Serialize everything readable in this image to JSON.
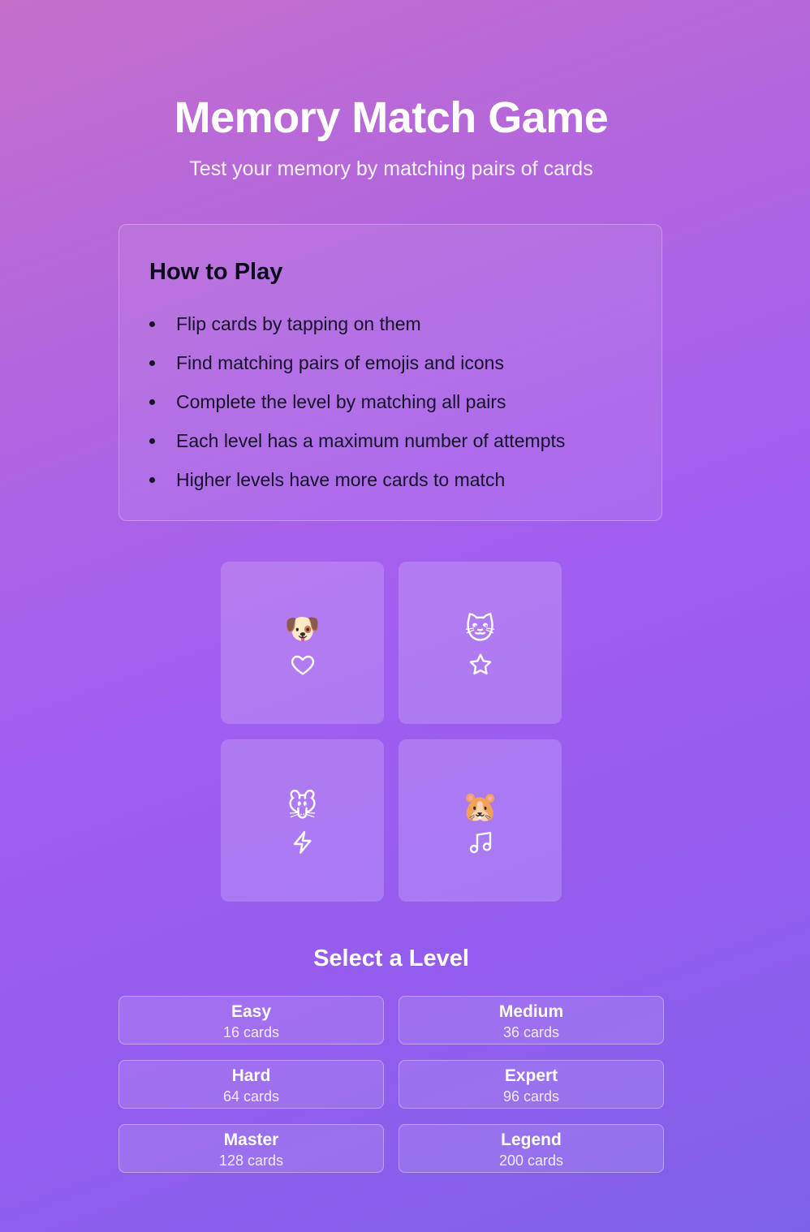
{
  "header": {
    "title": "Memory Match Game",
    "subtitle": "Test your memory by matching pairs of cards"
  },
  "how_to_play": {
    "heading": "How to Play",
    "rules": [
      "Flip cards by tapping on them",
      "Find matching pairs of emojis and icons",
      "Complete the level by matching all pairs",
      "Each level has a maximum number of attempts",
      "Higher levels have more cards to match"
    ]
  },
  "preview_cards": [
    {
      "emoji": "🐶",
      "icon": "heart-icon"
    },
    {
      "emoji": "🐱",
      "icon": "star-icon"
    },
    {
      "emoji": "🐭",
      "icon": "lightning-icon"
    },
    {
      "emoji": "🐹",
      "icon": "music-note-icon"
    }
  ],
  "level_select": {
    "heading": "Select a Level",
    "levels": [
      {
        "name": "Easy",
        "cards": "16 cards"
      },
      {
        "name": "Medium",
        "cards": "36 cards"
      },
      {
        "name": "Hard",
        "cards": "64 cards"
      },
      {
        "name": "Expert",
        "cards": "96 cards"
      },
      {
        "name": "Master",
        "cards": "128 cards"
      },
      {
        "name": "Legend",
        "cards": "200 cards"
      }
    ]
  },
  "colors": {
    "gradient_start": "#c56fcb",
    "gradient_mid": "#a15ef0",
    "gradient_end": "#7d62e9",
    "text_primary": "#ffffff",
    "text_dark": "#15112b"
  }
}
